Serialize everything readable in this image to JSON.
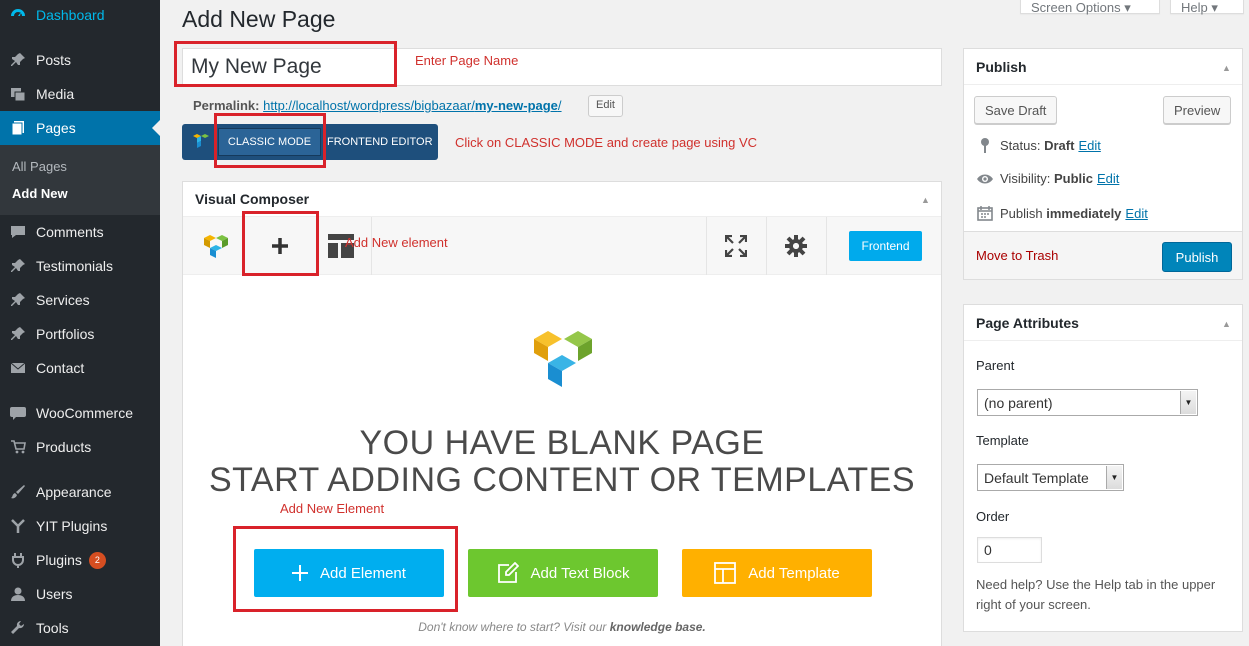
{
  "sidebar": {
    "dashboard": "Dashboard",
    "items": [
      {
        "label": "Posts",
        "icon": "pin-icon"
      },
      {
        "label": "Media",
        "icon": "media-icon"
      },
      {
        "label": "Pages",
        "icon": "pages-icon"
      },
      {
        "label": "Comments",
        "icon": "comments-icon"
      },
      {
        "label": "Testimonials",
        "icon": "pin-icon"
      },
      {
        "label": "Services",
        "icon": "pin-icon"
      },
      {
        "label": "Portfolios",
        "icon": "pin-icon"
      },
      {
        "label": "Contact",
        "icon": "mail-icon"
      },
      {
        "label": "WooCommerce",
        "icon": "woo-icon"
      },
      {
        "label": "Products",
        "icon": "cart-icon"
      },
      {
        "label": "Appearance",
        "icon": "brush-icon"
      },
      {
        "label": "YIT Plugins",
        "icon": "yit-icon"
      },
      {
        "label": "Plugins",
        "icon": "plug-icon",
        "badge": "2"
      },
      {
        "label": "Users",
        "icon": "user-icon"
      },
      {
        "label": "Tools",
        "icon": "wrench-icon"
      }
    ],
    "submenu": {
      "all_pages": "All Pages",
      "add_new": "Add New"
    }
  },
  "header": {
    "title": "Add New Page",
    "screen_options": "Screen Options",
    "help": "Help"
  },
  "editor": {
    "title_value": "My New Page",
    "permalink_label": "Permalink:",
    "permalink_base": "http://localhost/wordpress/bigbazaar/",
    "permalink_slug": "my-new-page",
    "permalink_end": "/",
    "permalink_edit": "Edit",
    "classic_mode": "CLASSIC MODE",
    "frontend_editor": "FRONTEND EDITOR"
  },
  "annotations": {
    "enter_page_name": "Enter Page Name",
    "click_classic": "Click on CLASSIC MODE and create page using VC",
    "add_new_element_toolbar": "Add New element",
    "add_new_element": "Add New Element"
  },
  "visual_composer": {
    "title": "Visual Composer",
    "frontend_button": "Frontend",
    "blank_line1": "YOU HAVE BLANK PAGE",
    "blank_line2": "START ADDING CONTENT OR TEMPLATES",
    "add_element": "Add Element",
    "add_text_block": "Add Text Block",
    "add_template": "Add Template",
    "kb_prefix": "Don't know where to start? Visit our",
    "kb_link": "knowledge base.",
    "colors": {
      "add_element": "#00aeef",
      "add_text_block": "#6dc72f",
      "add_template": "#ffb000"
    }
  },
  "publish": {
    "title": "Publish",
    "save_draft": "Save Draft",
    "preview": "Preview",
    "status_label": "Status:",
    "status_value": "Draft",
    "visibility_label": "Visibility:",
    "visibility_value": "Public",
    "publish_label": "Publish",
    "publish_value": "immediately",
    "edit": "Edit",
    "move_to_trash": "Move to Trash",
    "publish_button": "Publish"
  },
  "page_attributes": {
    "title": "Page Attributes",
    "parent_label": "Parent",
    "parent_value": "(no parent)",
    "template_label": "Template",
    "template_value": "Default Template",
    "order_label": "Order",
    "order_value": "0",
    "help_text": "Need help? Use the Help tab in the upper right of your screen."
  }
}
